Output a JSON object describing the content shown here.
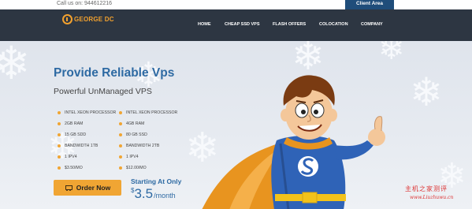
{
  "topbar": {
    "call_us": "Call us on: 944612216",
    "client_area": "Client Area"
  },
  "brand": {
    "logo_text": "GEORGE DC",
    "accent_color": "#f2a12e",
    "nav_bg": "#2d3642",
    "title_color": "#2e6aa3"
  },
  "nav": {
    "items": [
      {
        "label": "HOME"
      },
      {
        "label": "CHEAP SSD VPS"
      },
      {
        "label": "FLASH OFFERS"
      },
      {
        "label": "COLOCATION"
      },
      {
        "label": "COMPANY"
      }
    ]
  },
  "hero": {
    "title": "Provide Reliable Vps",
    "subtitle": "Powerful UnManaged VPS",
    "plans": [
      {
        "features": [
          "INTEL XEON Processor",
          "2GB RAM",
          "15 GB SDD",
          "BANDWIDTH 1TB",
          "1 IPV4",
          "$3.50/mo"
        ]
      },
      {
        "features": [
          "INTEL XEON Processor",
          "4GB RAM",
          "80 GB SSD",
          "BANDWIDTH 2TB",
          "1 IPV4",
          "$12.00/mo"
        ]
      }
    ],
    "order_button": "Order Now",
    "starting_label": "Starting At Only",
    "price_currency": "$",
    "price_amount": "3.5",
    "price_period": "/month"
  },
  "watermark": {
    "text": "主机之家测评",
    "url": "www.Liuzhuwu.cn"
  },
  "icons": {
    "logo": "logo-ring-icon",
    "cart": "cart-icon",
    "decor": "snowflake-icon"
  }
}
